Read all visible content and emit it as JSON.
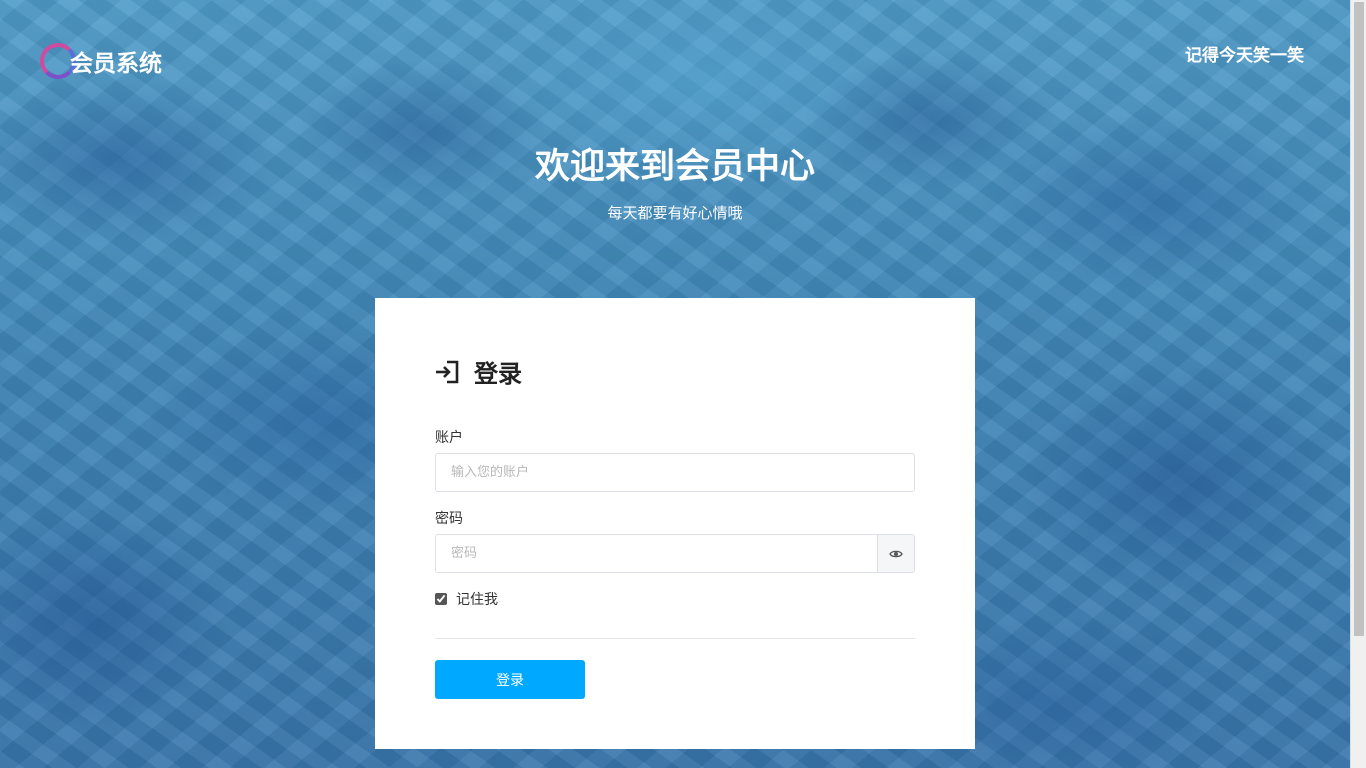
{
  "header": {
    "logo_text": "会员系统",
    "motto": "记得今天笑一笑"
  },
  "hero": {
    "title": "欢迎来到会员中心",
    "subtitle": "每天都要有好心情哦"
  },
  "login_form": {
    "title": "登录",
    "title_icon": "sign-in-icon",
    "account_label": "账户",
    "account_placeholder": "输入您的账户",
    "account_value": "",
    "password_label": "密码",
    "password_placeholder": "密码",
    "password_value": "",
    "password_toggle_icon": "eye-icon",
    "remember_label": "记住我",
    "remember_checked": true,
    "submit_label": "登录",
    "submit_color": "#00a8ff"
  }
}
